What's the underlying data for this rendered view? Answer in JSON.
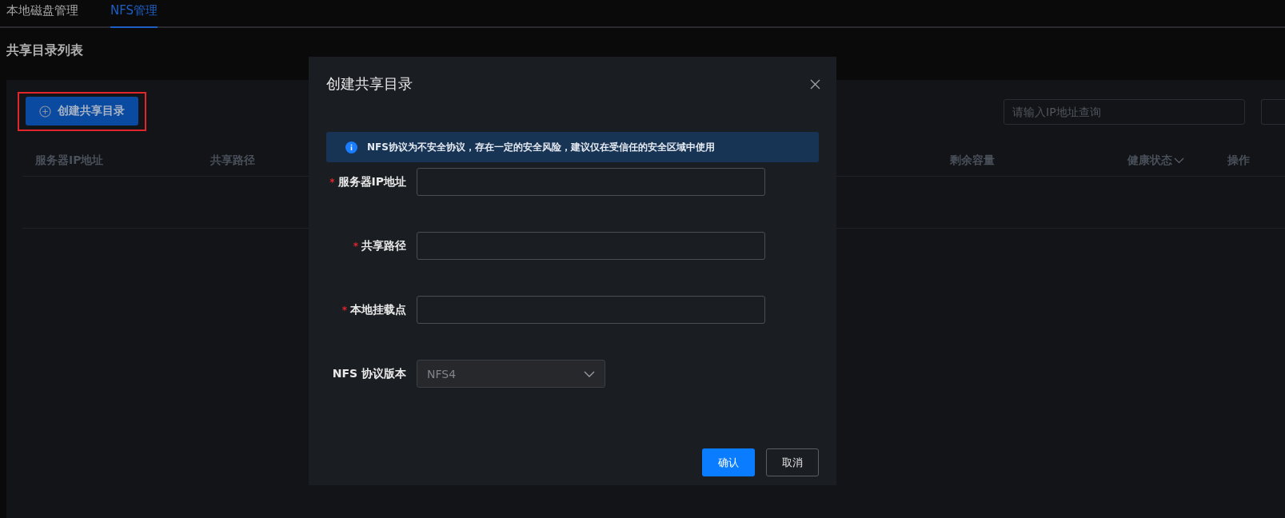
{
  "tabs": [
    {
      "label": "本地磁盘管理",
      "selected": false
    },
    {
      "label": "NFS管理",
      "selected": true
    }
  ],
  "section_title": "共享目录列表",
  "create_button": {
    "label": "创建共享目录",
    "highlighted": true
  },
  "search": {
    "placeholder": "请输入IP地址查询"
  },
  "table": {
    "columns": [
      {
        "label": "服务器IP地址",
        "has_dropdown": false
      },
      {
        "label": "共享路径",
        "has_dropdown": false
      },
      {
        "label": "剩余容量",
        "has_dropdown": false
      },
      {
        "label": "健康状态",
        "has_dropdown": true
      },
      {
        "label": "操作",
        "has_dropdown": false
      }
    ]
  },
  "dialog": {
    "title": "创建共享目录",
    "notice": "NFS协议为不安全协议，存在一定的安全风险，建议仅在受信任的安全区域中使用",
    "fields": [
      {
        "kind": "input",
        "label": "服务器IP地址",
        "required_mark": "*"
      },
      {
        "kind": "input",
        "label": "共享路径",
        "required_mark": "*"
      },
      {
        "kind": "input",
        "label": "本地挂载点",
        "required_mark": "*"
      },
      {
        "kind": "select",
        "label": "NFS 协议版本",
        "value": "NFS4"
      }
    ],
    "buttons": [
      {
        "label": "确认",
        "kind": "primary"
      },
      {
        "label": "取消",
        "kind": "secondary"
      }
    ]
  }
}
